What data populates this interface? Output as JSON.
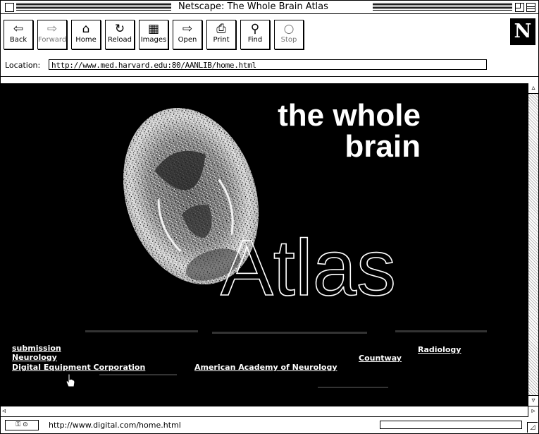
{
  "window": {
    "title": "Netscape: The Whole Brain Atlas"
  },
  "toolbar": {
    "buttons": [
      {
        "label": "Back",
        "icon": "back-arrow-icon",
        "glyph": "⇦"
      },
      {
        "label": "Forward",
        "icon": "forward-arrow-icon",
        "glyph": "⇨"
      },
      {
        "label": "Home",
        "icon": "home-icon",
        "glyph": "⌂"
      },
      {
        "label": "Reload",
        "icon": "reload-icon",
        "glyph": "↻"
      },
      {
        "label": "Images",
        "icon": "images-icon",
        "glyph": "▦"
      },
      {
        "label": "Open",
        "icon": "open-icon",
        "glyph": "⇨"
      },
      {
        "label": "Print",
        "icon": "print-icon",
        "glyph": "⎙"
      },
      {
        "label": "Find",
        "icon": "find-icon",
        "glyph": "⚲"
      },
      {
        "label": "Stop",
        "icon": "stop-icon",
        "glyph": "○"
      }
    ],
    "logo": "N"
  },
  "location": {
    "label": "Location:",
    "url": "http://www.med.harvard.edu:80/AANLIB/home.html"
  },
  "page": {
    "heading_line1": "the whole",
    "heading_line2": "brain",
    "heading_atlas": "Atlas",
    "links": [
      "submission",
      "Neurology",
      "Digital Equipment Corporation",
      "American Academy of Neurology",
      "Countway",
      "Radiology"
    ]
  },
  "status": {
    "text": "http://www.digital.com/home.html"
  },
  "colors": {
    "page_background": "#000000",
    "text": "#ffffff",
    "chrome": "#ffffff"
  }
}
